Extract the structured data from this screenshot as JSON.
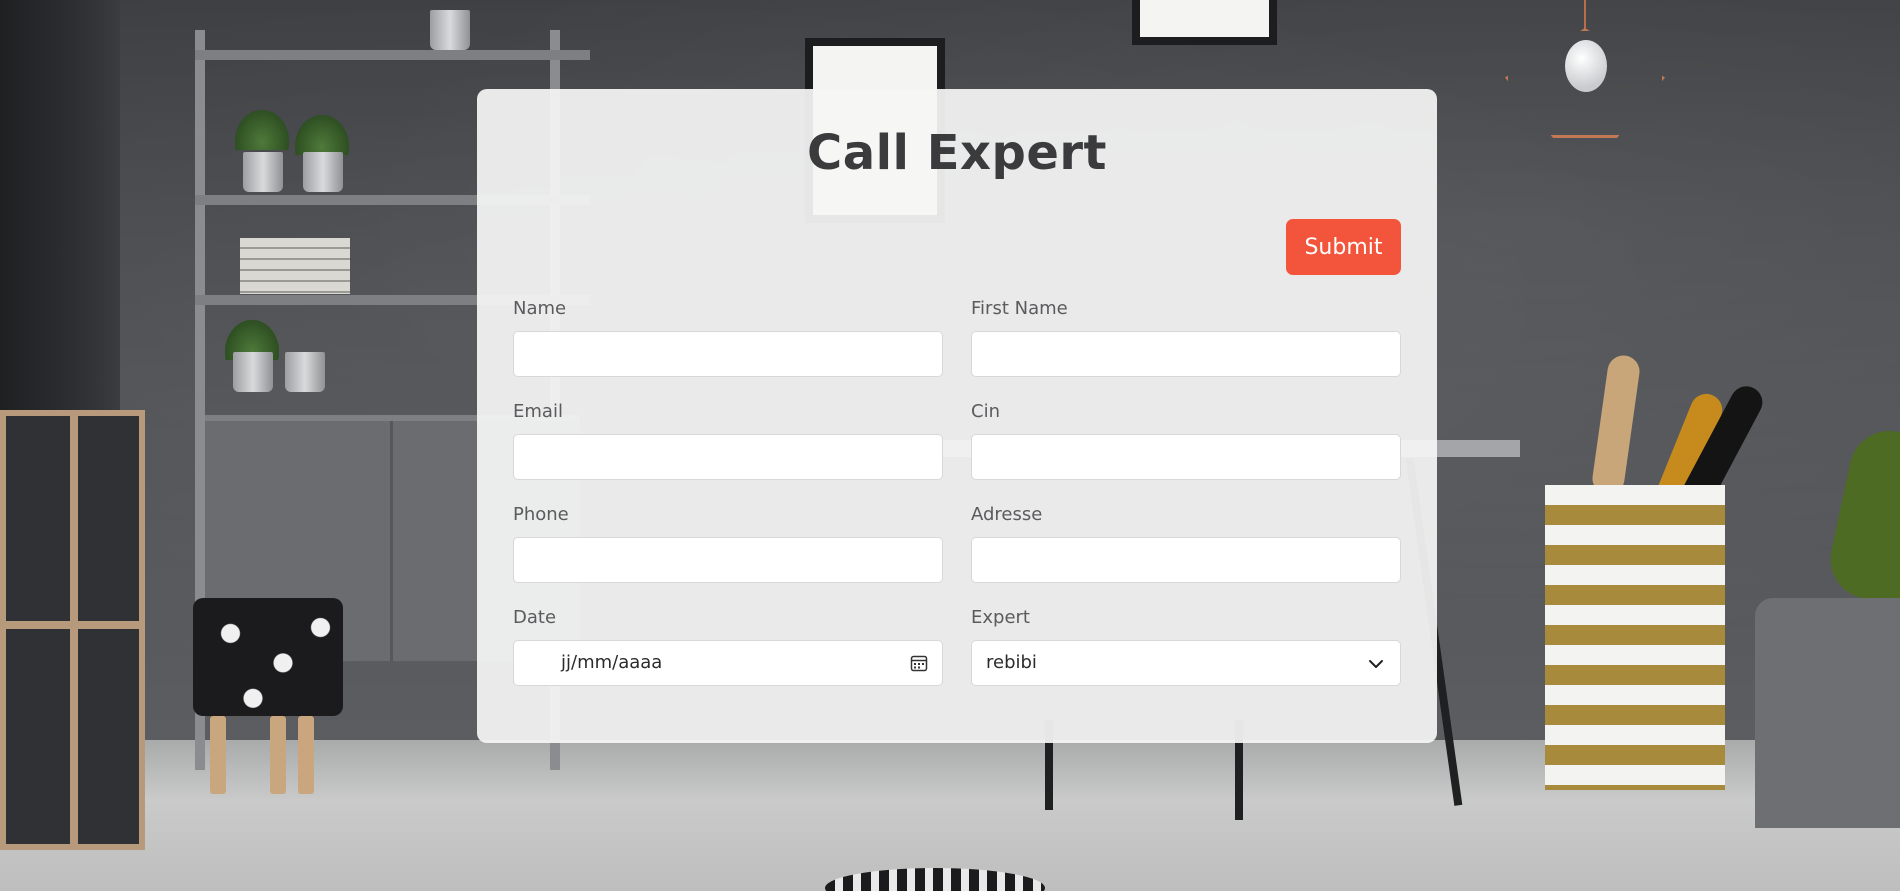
{
  "form": {
    "title": "Call Expert",
    "submit_label": "Submit",
    "fields": {
      "name": {
        "label": "Name",
        "value": ""
      },
      "first_name": {
        "label": "First Name",
        "value": ""
      },
      "email": {
        "label": "Email",
        "value": ""
      },
      "cin": {
        "label": "Cin",
        "value": ""
      },
      "phone": {
        "label": "Phone",
        "value": ""
      },
      "adresse": {
        "label": "Adresse",
        "value": ""
      },
      "date": {
        "label": "Date",
        "placeholder": "jj/mm/aaaa"
      },
      "expert": {
        "label": "Expert",
        "selected": "rebibi"
      }
    }
  },
  "colors": {
    "accent": "#f2553b",
    "card_background": "#f5f5f5",
    "title_text": "#3b3b3d"
  },
  "icons": {
    "date": "calendar-icon",
    "select": "chevron-down-icon"
  }
}
